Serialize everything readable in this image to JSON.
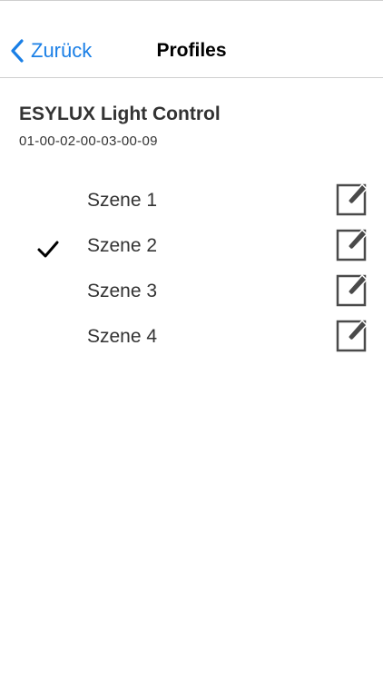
{
  "navbar": {
    "back_label": "Zurück",
    "title": "Profiles"
  },
  "device": {
    "name": "ESYLUX Light Control",
    "id": "01-00-02-00-03-00-09"
  },
  "scenes": [
    {
      "label": "Szene 1",
      "selected": false,
      "edit_icon": "edit-icon"
    },
    {
      "label": "Szene 2",
      "selected": true,
      "edit_icon": "edit-icon"
    },
    {
      "label": "Szene 3",
      "selected": false,
      "edit_icon": "edit-icon"
    },
    {
      "label": "Szene 4",
      "selected": false,
      "edit_icon": "edit-icon"
    }
  ],
  "colors": {
    "accent": "#1a7fe6",
    "text": "#333333",
    "icon": "#4a4a4a",
    "separator": "#cfcfcf"
  }
}
